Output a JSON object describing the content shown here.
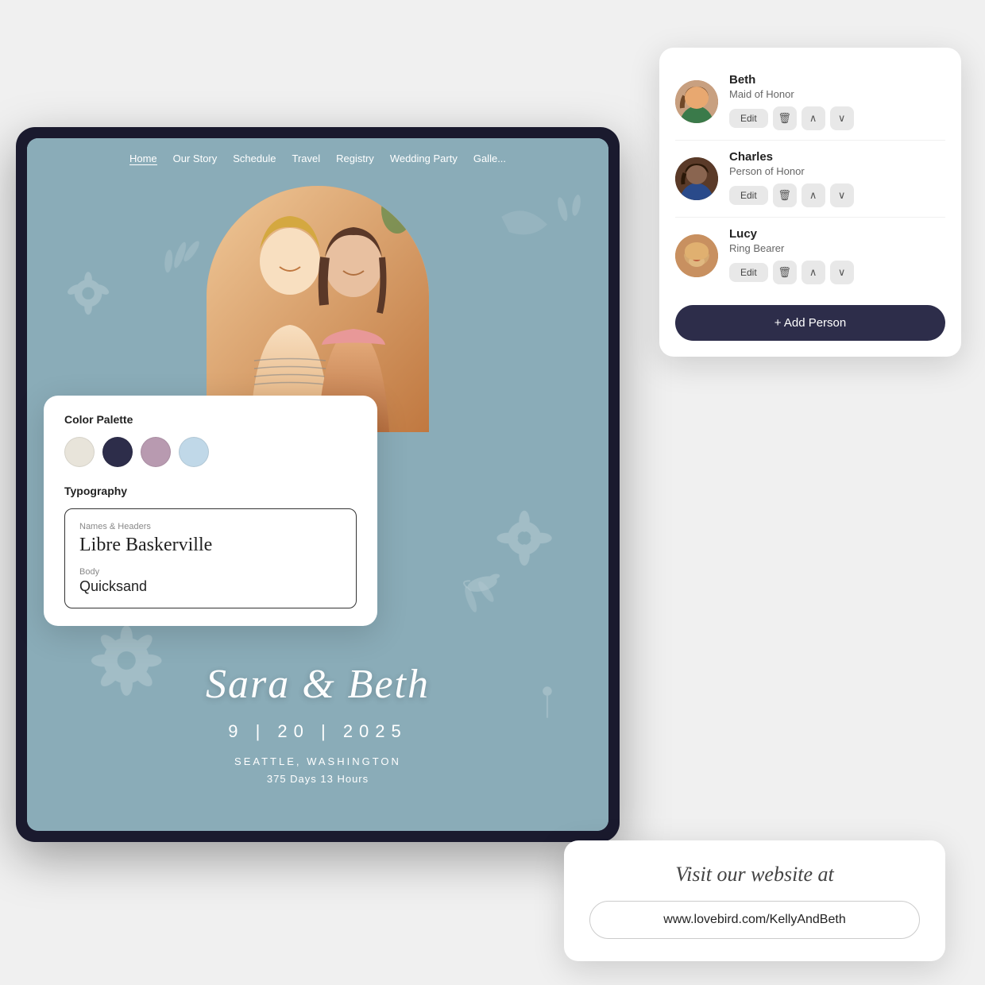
{
  "tablet": {
    "nav": {
      "items": [
        "Home",
        "Our Story",
        "Schedule",
        "Travel",
        "Registry",
        "Wedding Party",
        "Galle..."
      ],
      "active": "Home"
    },
    "couple": {
      "names": "Sara & Beth",
      "date": "9  |  20  |  2025",
      "location": "SEATTLE, WASHINGTON",
      "countdown": "375 Days  13 Hours"
    }
  },
  "party_card": {
    "members": [
      {
        "name": "Beth",
        "role": "Maid of Honor",
        "avatar_type": "beth"
      },
      {
        "name": "Charles",
        "role": "Person of Honor",
        "avatar_type": "charles"
      },
      {
        "name": "Lucy",
        "role": "Ring Bearer",
        "avatar_type": "lucy"
      }
    ],
    "edit_label": "Edit",
    "add_label": "+ Add Person"
  },
  "palette_card": {
    "title": "Color Palette",
    "colors": [
      "#e8e4da",
      "#2d2d4a",
      "#b89ab0",
      "#c0d8e8"
    ],
    "typography_title": "Typography",
    "names_headers_label": "Names & Headers",
    "font_name": "Libre Baskerville",
    "body_label": "Body",
    "body_font": "Quicksand"
  },
  "website_card": {
    "visit_text": "Visit our website at",
    "url": "www.lovebird.com/KellyAndBeth"
  },
  "icons": {
    "trash": "🗑",
    "chevron_up": "∧",
    "chevron_down": "∨",
    "plus": "+"
  }
}
